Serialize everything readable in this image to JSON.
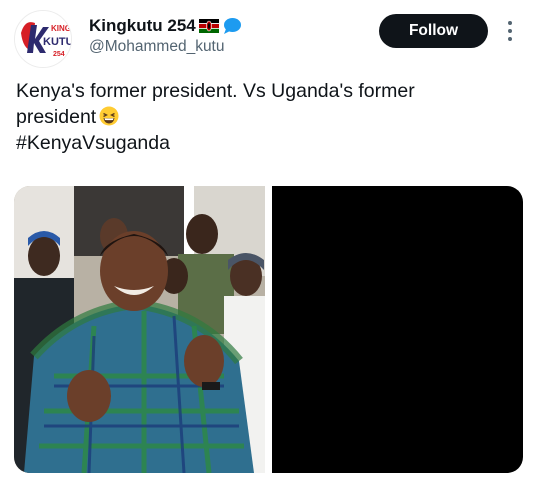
{
  "user": {
    "display_name": "Kingkutu 254",
    "handle": "@Mohammed_kutu",
    "flag_icon": "kenya-flag-icon",
    "badge_icon": "speech-bubble-icon",
    "avatar_logo_text": [
      "KING",
      "KUTU",
      "254"
    ]
  },
  "actions": {
    "follow_label": "Follow",
    "more_icon": "more-vertical-icon"
  },
  "tweet": {
    "line1": "Kenya's former president.  Vs  Uganda's former",
    "line2": "president",
    "line3": "#KenyaVsuganda",
    "emoji": "grinning-squinting-face-emoji"
  },
  "colors": {
    "follow_bg": "#0f1419",
    "handle": "#536471",
    "flag_green": "#006600",
    "flag_red": "#bb0000",
    "bubble_blue": "#1d9bf0"
  }
}
